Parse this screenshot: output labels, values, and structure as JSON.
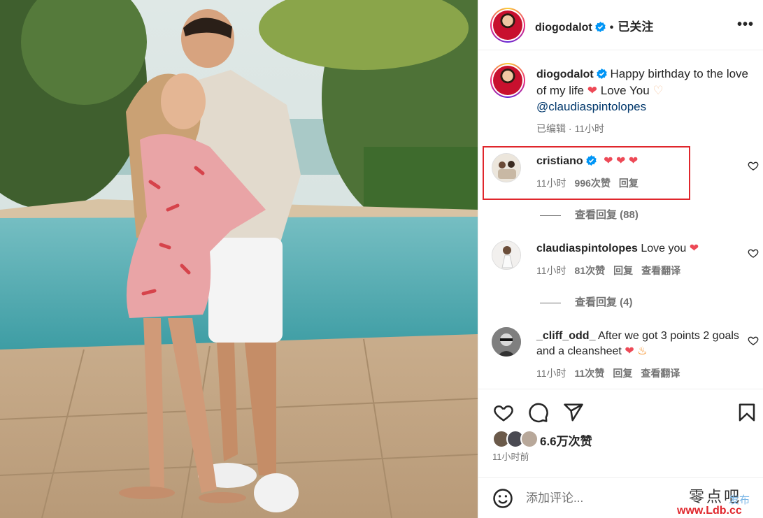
{
  "post": {
    "username": "diogodalot",
    "follow_state": "已关注",
    "more_label": "•••",
    "caption_text": "Happy birthday to the love of my life",
    "caption_text2": "Love You",
    "caption_mention": "@claudiaspintolopes",
    "caption_meta": "已编辑 · 11小时"
  },
  "comments": [
    {
      "username": "cristiano",
      "text": "",
      "time": "11小时",
      "likes": "996次赞",
      "reply": "回复",
      "view_replies": "查看回复 (88)"
    },
    {
      "username": "claudiaspintolopes",
      "text": "Love you",
      "time": "11小时",
      "likes": "81次赞",
      "reply": "回复",
      "translate": "查看翻译",
      "view_replies": "查看回复 (4)"
    },
    {
      "username": "_cliff_odd_",
      "text": "After we got 3 points 2 goals and a cleansheet",
      "time": "11小时",
      "likes": "11次赞",
      "reply": "回复",
      "translate": "查看翻译"
    }
  ],
  "footer": {
    "likes": "6.6万次赞",
    "posted": "11小时前",
    "comment_placeholder": "添加评论..."
  },
  "watermark": {
    "line1": "零点吧",
    "line2": "发布",
    "line3": "www.Ldb.cc"
  },
  "icons": [
    "heart-icon",
    "comment-icon",
    "share-icon",
    "bookmark-icon",
    "emoji-icon",
    "verified-icon",
    "more-icon"
  ],
  "colors": {
    "verified": "#0095f6",
    "heart": "#ed4956",
    "highlight_box": "#e0262c",
    "link": "#00376b"
  }
}
